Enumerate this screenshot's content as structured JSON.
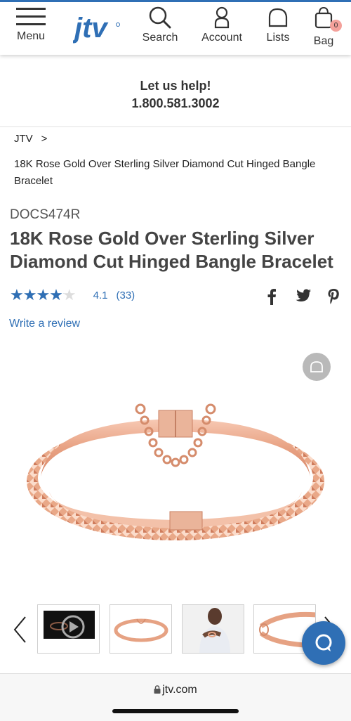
{
  "header": {
    "menu_label": "Menu",
    "logo_text": "jtv",
    "search_label": "Search",
    "account_label": "Account",
    "lists_label": "Lists",
    "bag_label": "Bag",
    "bag_count": "0",
    "accent_color": "#2f6fb5"
  },
  "help": {
    "line1": "Let us help!",
    "phone": "1.800.581.3002"
  },
  "breadcrumb": {
    "root": "JTV",
    "separator": ">",
    "current": "18K Rose Gold Over Sterling Silver Diamond Cut Hinged Bangle Bracelet"
  },
  "product": {
    "sku": "DOCS474R",
    "title": "18K Rose Gold Over Sterling Silver Diamond Cut Hinged Bangle Bracelet",
    "rating": 4.1,
    "rating_text": "4.1",
    "review_count": "(33)",
    "stars_glyphs": "★★★★★",
    "write_review": "Write a review"
  },
  "social": {
    "icons": [
      "facebook-icon",
      "twitter-icon",
      "pinterest-icon"
    ]
  },
  "gallery": {
    "thumbnails": [
      "video-thumbnail",
      "bangle-front-thumbnail",
      "model-wearing-thumbnail",
      "bangle-detail-thumbnail"
    ]
  },
  "browser": {
    "url": "jtv.com"
  }
}
